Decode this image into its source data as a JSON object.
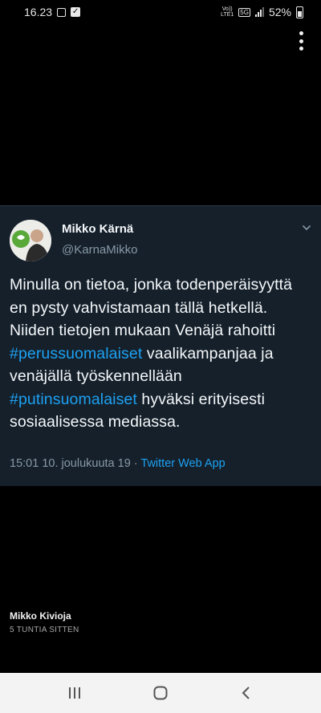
{
  "status_bar": {
    "time": "16.23",
    "net_top": "Vo))",
    "net_bottom": "LTE1",
    "net_5g": "5G",
    "battery": "52%"
  },
  "tweet": {
    "author_name": "Mikko Kärnä",
    "author_handle": "@KarnaMikko",
    "text_part1": "Minulla on tietoa, jonka todenperäisyyttä en pysty vahvistamaan tällä hetkellä. Niiden tietojen mukaan Venäjä rahoitti ",
    "hashtag1": "#perussuomalaiset",
    "text_part2": " vaalikampanjaa ja venäjällä työskennellään ",
    "hashtag2": "#putinsuomalaiset",
    "text_part3": " hyväksi erityisesti sosiaalisessa mediassa.",
    "timestamp": "15:01 10. joulukuuta 19 · ",
    "source_app": "Twitter Web App"
  },
  "post": {
    "poster_name": "Mikko Kivioja",
    "posted_ago": "5 TUNTIA SITTEN"
  },
  "icons": {
    "gallery": "gallery-icon",
    "check": "check-icon",
    "kebab": "more-options-icon",
    "chevron": "chevron-down-icon",
    "nav_recent": "recent-apps-icon",
    "nav_home": "home-icon",
    "nav_back": "back-icon"
  },
  "colors": {
    "tweet_bg": "#15202b",
    "link": "#1da1f2",
    "secondary_text": "#8899a6"
  }
}
